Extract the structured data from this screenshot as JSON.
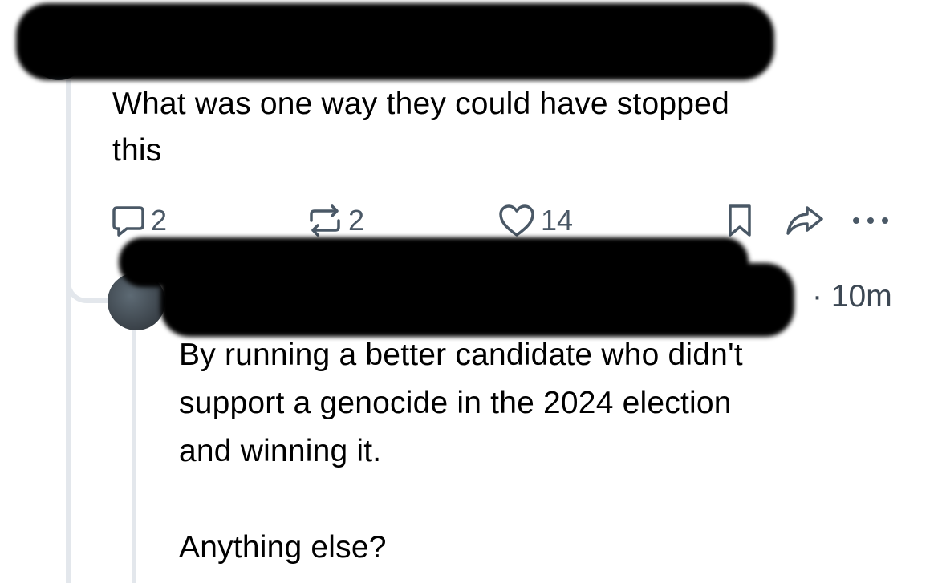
{
  "first_post": {
    "text": "What was one way they could have stopped\nthis",
    "actions": {
      "reply_count": "2",
      "repost_count": "2",
      "like_count": "14"
    }
  },
  "reply": {
    "meta": "· 10m",
    "text": "By running a better candidate who didn't\nsupport a genocide in the 2024 election\nand winning it.\n\nAnything else?"
  },
  "icons": {
    "reply": "speech-bubble-icon",
    "repost": "repost-arrows-icon",
    "like": "heart-icon",
    "bookmark": "bookmark-icon",
    "share": "share-arrow-icon",
    "more": "ellipsis-icon"
  },
  "colors": {
    "icon": "#4a5866",
    "thread_line": "#e3e7ec",
    "redaction": "#000000"
  }
}
